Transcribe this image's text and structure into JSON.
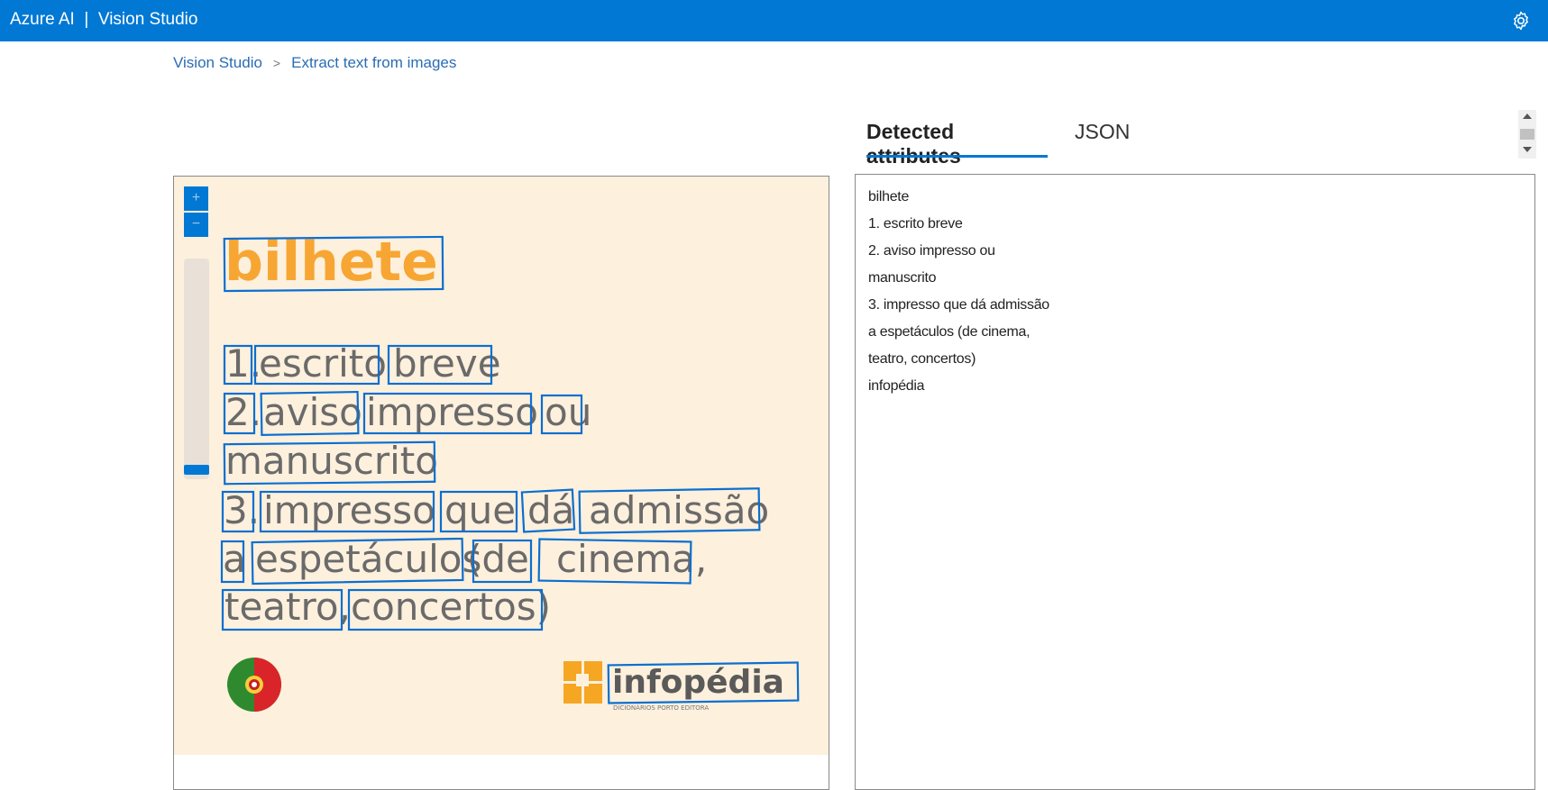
{
  "app": {
    "brand": "Azure AI  |  Vision Studio",
    "settings_icon": "gear-icon"
  },
  "breadcrumb": {
    "items": [
      "Vision Studio",
      "Extract text from images"
    ],
    "separator": ">"
  },
  "canvas": {
    "zoom_in_label": "+",
    "zoom_out_label": "−",
    "image": {
      "background": "#fdf0dd",
      "box_color": "#0a6fd0",
      "title": "bilhete",
      "lines": [
        [
          "1.",
          "escrito",
          "breve"
        ],
        [
          "2.",
          "aviso",
          "impresso",
          "ou"
        ],
        [
          "manuscrito"
        ],
        [
          "3.",
          "impresso",
          "que",
          "dá",
          "admissão"
        ],
        [
          "a",
          "espetáculos",
          "(de",
          "cinema,"
        ],
        [
          "teatro,",
          "concertos)"
        ]
      ],
      "logo_text": "infopédia",
      "logo_subtext": "DICIONÁRIOS PORTO EDITORA",
      "flag_icon": "portugal-flag-icon",
      "logo_icon": "infopedia-logo-icon"
    }
  },
  "tabs": [
    {
      "label": "Detected attributes",
      "active": true
    },
    {
      "label": "JSON",
      "active": false
    }
  ],
  "results": {
    "lines": [
      "bilhete",
      "1. escrito breve",
      "2. aviso impresso ou",
      "manuscrito",
      "3. impresso que dá admissão",
      "a espetáculos (de cinema,",
      "teatro, concertos)",
      "infopédia"
    ]
  }
}
